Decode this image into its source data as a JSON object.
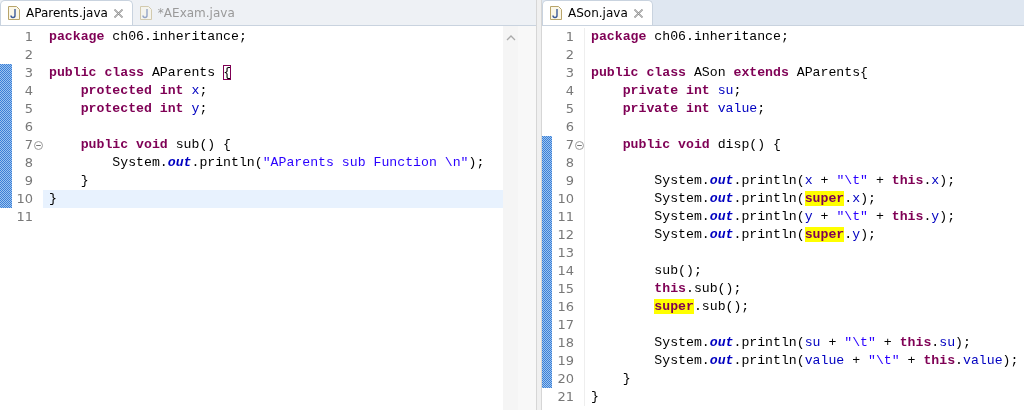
{
  "editors": [
    {
      "tabs": [
        {
          "label": "AParents.java",
          "selected": true,
          "closable": true
        },
        {
          "label": "*AExam.java",
          "selected": false,
          "closable": false
        }
      ],
      "scrollbar": true,
      "lines": [
        {
          "number": "1",
          "changed": false,
          "current": false,
          "fold": false,
          "tokens": [
            {
              "kind": "keyword",
              "text": "package"
            },
            {
              "kind": "plain",
              "text": " ch06.inheritance;"
            }
          ]
        },
        {
          "number": "2",
          "changed": false,
          "current": false,
          "fold": false
        },
        {
          "number": "3",
          "changed": true,
          "current": false,
          "fold": false,
          "tokens": [
            {
              "kind": "keyword",
              "text": "public class"
            },
            {
              "kind": "plain",
              "text": " AParents "
            },
            {
              "kind": "bracket-match",
              "text": "{"
            }
          ]
        },
        {
          "number": "4",
          "changed": true,
          "current": false,
          "fold": false,
          "tokens": [
            {
              "kind": "keyword",
              "text": "    protected int"
            },
            {
              "kind": "field",
              "text": " x"
            },
            {
              "kind": "plain",
              "text": ";"
            }
          ]
        },
        {
          "number": "5",
          "changed": true,
          "current": false,
          "fold": false,
          "tokens": [
            {
              "kind": "keyword",
              "text": "    protected int"
            },
            {
              "kind": "field",
              "text": " y"
            },
            {
              "kind": "plain",
              "text": ";"
            }
          ]
        },
        {
          "number": "6",
          "changed": true,
          "current": false,
          "fold": false
        },
        {
          "number": "7",
          "changed": true,
          "current": false,
          "fold": true,
          "tokens": [
            {
              "kind": "keyword",
              "text": "    public void"
            },
            {
              "kind": "plain",
              "text": " sub() {"
            }
          ]
        },
        {
          "number": "8",
          "changed": true,
          "current": false,
          "fold": false,
          "tokens": [
            {
              "kind": "plain",
              "text": "        System."
            },
            {
              "kind": "static-field",
              "text": "out"
            },
            {
              "kind": "plain",
              "text": ".println("
            },
            {
              "kind": "string",
              "text": "\"AParents sub Function \\n\""
            },
            {
              "kind": "plain",
              "text": ");"
            }
          ]
        },
        {
          "number": "9",
          "changed": true,
          "current": false,
          "fold": false,
          "tokens": [
            {
              "kind": "plain",
              "text": "    }"
            }
          ]
        },
        {
          "number": "10",
          "changed": true,
          "current": true,
          "fold": false,
          "tokens": [
            {
              "kind": "plain",
              "text": "}"
            }
          ]
        },
        {
          "number": "11",
          "changed": false,
          "current": false,
          "fold": false
        }
      ]
    },
    {
      "tabs": [
        {
          "label": "ASon.java",
          "selected": true,
          "closable": true
        }
      ],
      "scrollbar": false,
      "lines": [
        {
          "number": "1",
          "changed": false,
          "current": false,
          "fold": false,
          "tokens": [
            {
              "kind": "keyword",
              "text": "package"
            },
            {
              "kind": "plain",
              "text": " ch06.inheritance;"
            }
          ]
        },
        {
          "number": "2",
          "changed": false,
          "current": false,
          "fold": false
        },
        {
          "number": "3",
          "changed": false,
          "current": false,
          "fold": false,
          "tokens": [
            {
              "kind": "keyword",
              "text": "public class"
            },
            {
              "kind": "plain",
              "text": " ASon "
            },
            {
              "kind": "keyword",
              "text": "extends"
            },
            {
              "kind": "plain",
              "text": " AParents{"
            }
          ]
        },
        {
          "number": "4",
          "changed": false,
          "current": false,
          "fold": false,
          "tokens": [
            {
              "kind": "keyword",
              "text": "    private int"
            },
            {
              "kind": "field",
              "text": " su"
            },
            {
              "kind": "plain",
              "text": ";"
            }
          ]
        },
        {
          "number": "5",
          "changed": false,
          "current": false,
          "fold": false,
          "tokens": [
            {
              "kind": "keyword",
              "text": "    private int"
            },
            {
              "kind": "field",
              "text": " value"
            },
            {
              "kind": "plain",
              "text": ";"
            }
          ]
        },
        {
          "number": "6",
          "changed": false,
          "current": false,
          "fold": false
        },
        {
          "number": "7",
          "changed": true,
          "current": false,
          "fold": true,
          "tokens": [
            {
              "kind": "keyword",
              "text": "    public void"
            },
            {
              "kind": "plain",
              "text": " disp() {"
            }
          ]
        },
        {
          "number": "8",
          "changed": true,
          "current": false,
          "fold": false
        },
        {
          "number": "9",
          "changed": true,
          "current": false,
          "fold": false,
          "tokens": [
            {
              "kind": "plain",
              "text": "        System."
            },
            {
              "kind": "static-field",
              "text": "out"
            },
            {
              "kind": "plain",
              "text": ".println("
            },
            {
              "kind": "field",
              "text": "x"
            },
            {
              "kind": "plain",
              "text": " + "
            },
            {
              "kind": "string",
              "text": "\"\\t\""
            },
            {
              "kind": "plain",
              "text": " + "
            },
            {
              "kind": "keyword",
              "text": "this"
            },
            {
              "kind": "plain",
              "text": "."
            },
            {
              "kind": "field",
              "text": "x"
            },
            {
              "kind": "plain",
              "text": ");"
            }
          ]
        },
        {
          "number": "10",
          "changed": true,
          "current": false,
          "fold": false,
          "tokens": [
            {
              "kind": "plain",
              "text": "        System."
            },
            {
              "kind": "static-field",
              "text": "out"
            },
            {
              "kind": "plain",
              "text": ".println("
            },
            {
              "kind": "keyword-marked",
              "text": "super"
            },
            {
              "kind": "plain",
              "text": "."
            },
            {
              "kind": "field",
              "text": "x"
            },
            {
              "kind": "plain",
              "text": ");"
            }
          ]
        },
        {
          "number": "11",
          "changed": true,
          "current": false,
          "fold": false,
          "tokens": [
            {
              "kind": "plain",
              "text": "        System."
            },
            {
              "kind": "static-field",
              "text": "out"
            },
            {
              "kind": "plain",
              "text": ".println("
            },
            {
              "kind": "field",
              "text": "y"
            },
            {
              "kind": "plain",
              "text": " + "
            },
            {
              "kind": "string",
              "text": "\"\\t\""
            },
            {
              "kind": "plain",
              "text": " + "
            },
            {
              "kind": "keyword",
              "text": "this"
            },
            {
              "kind": "plain",
              "text": "."
            },
            {
              "kind": "field",
              "text": "y"
            },
            {
              "kind": "plain",
              "text": ");"
            }
          ]
        },
        {
          "number": "12",
          "changed": true,
          "current": false,
          "fold": false,
          "tokens": [
            {
              "kind": "plain",
              "text": "        System."
            },
            {
              "kind": "static-field",
              "text": "out"
            },
            {
              "kind": "plain",
              "text": ".println("
            },
            {
              "kind": "keyword-marked",
              "text": "super"
            },
            {
              "kind": "plain",
              "text": "."
            },
            {
              "kind": "field",
              "text": "y"
            },
            {
              "kind": "plain",
              "text": ");"
            }
          ]
        },
        {
          "number": "13",
          "changed": true,
          "current": false,
          "fold": false
        },
        {
          "number": "14",
          "changed": true,
          "current": false,
          "fold": false,
          "tokens": [
            {
              "kind": "plain",
              "text": "        sub();"
            }
          ]
        },
        {
          "number": "15",
          "changed": true,
          "current": false,
          "fold": false,
          "tokens": [
            {
              "kind": "keyword",
              "text": "        this"
            },
            {
              "kind": "plain",
              "text": ".sub();"
            }
          ]
        },
        {
          "number": "16",
          "changed": true,
          "current": false,
          "fold": false,
          "tokens": [
            {
              "kind": "keyword-marked",
              "text": "        super"
            },
            {
              "kind": "plain",
              "text": ".sub();"
            }
          ]
        },
        {
          "number": "17",
          "changed": true,
          "current": false,
          "fold": false
        },
        {
          "number": "18",
          "changed": true,
          "current": false,
          "fold": false,
          "tokens": [
            {
              "kind": "plain",
              "text": "        System."
            },
            {
              "kind": "static-field",
              "text": "out"
            },
            {
              "kind": "plain",
              "text": ".println("
            },
            {
              "kind": "field",
              "text": "su"
            },
            {
              "kind": "plain",
              "text": " + "
            },
            {
              "kind": "string",
              "text": "\"\\t\""
            },
            {
              "kind": "plain",
              "text": " + "
            },
            {
              "kind": "keyword",
              "text": "this"
            },
            {
              "kind": "plain",
              "text": "."
            },
            {
              "kind": "field",
              "text": "su"
            },
            {
              "kind": "plain",
              "text": ");"
            }
          ]
        },
        {
          "number": "19",
          "changed": true,
          "current": false,
          "fold": false,
          "tokens": [
            {
              "kind": "plain",
              "text": "        System."
            },
            {
              "kind": "static-field",
              "text": "out"
            },
            {
              "kind": "plain",
              "text": ".println("
            },
            {
              "kind": "field",
              "text": "value"
            },
            {
              "kind": "plain",
              "text": " + "
            },
            {
              "kind": "string",
              "text": "\"\\t\""
            },
            {
              "kind": "plain",
              "text": " + "
            },
            {
              "kind": "keyword",
              "text": "this"
            },
            {
              "kind": "plain",
              "text": "."
            },
            {
              "kind": "field",
              "text": "value"
            },
            {
              "kind": "plain",
              "text": ");"
            }
          ]
        },
        {
          "number": "20",
          "changed": true,
          "current": false,
          "fold": false,
          "tokens": [
            {
              "kind": "plain",
              "text": "    }"
            }
          ]
        },
        {
          "number": "21",
          "changed": false,
          "current": false,
          "fold": false,
          "tokens": [
            {
              "kind": "plain",
              "text": "}"
            }
          ]
        }
      ]
    }
  ]
}
